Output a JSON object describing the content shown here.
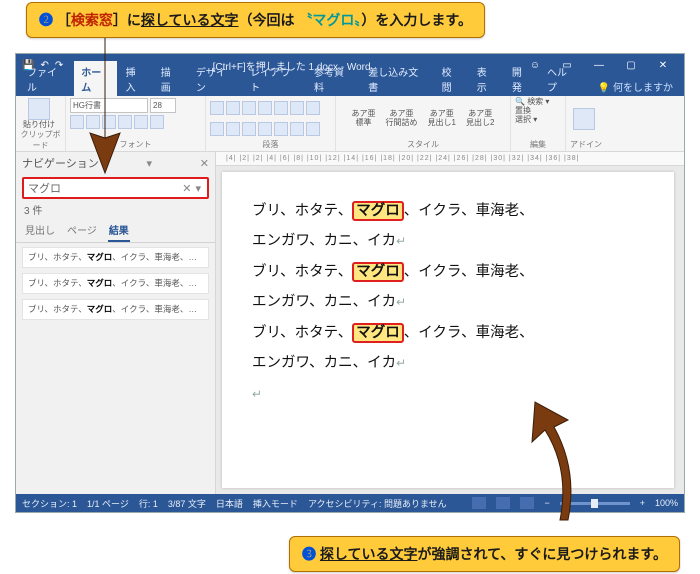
{
  "callouts": {
    "top": {
      "num": "❷",
      "p1": "［",
      "kw": "検索窓",
      "p2": "］に",
      "u": "探している文字",
      "p3": "（今回は ",
      "q": "〝マグロ〟",
      "p4": "）を入力します。"
    },
    "bot": {
      "num": "❸",
      "p1": " ",
      "u": "探している文字",
      "p2": "が強調されて、すぐに見つけられます。"
    }
  },
  "window": {
    "title": "[Ctrl+F]を押しました 1.docx - Word",
    "tabs": [
      "ファイル",
      "ホーム",
      "挿入",
      "描画",
      "デザイン",
      "レイアウト",
      "参考資料",
      "差し込み文書",
      "校閲",
      "表示",
      "開発",
      "ヘルプ"
    ],
    "tell": "何をしますか",
    "ribbon": {
      "font_name": "HG行書",
      "font_size": "28",
      "grp_clipboard": "クリップボード",
      "grp_font": "フォント",
      "grp_para": "段落",
      "grp_style": "スタイル",
      "grp_edit": "編集",
      "grp_addin": "アドイン",
      "style_labels": [
        "あア亜",
        "あア亜",
        "あア亜",
        "あア亜"
      ],
      "style_sub": [
        "標準",
        "行間詰め",
        "見出し1",
        "見出し2"
      ],
      "edit_items": [
        "検索",
        "置換",
        "選択"
      ]
    },
    "nav": {
      "heading": "ナビゲーション",
      "search_value": "マグロ",
      "count": "3 件",
      "tabs": [
        "見出し",
        "ページ",
        "結果"
      ],
      "row_pre": "ブリ、ホタテ、",
      "row_hit": "マグロ",
      "row_post": "、イクラ、車海老、エンガワ、カニ、イカ"
    },
    "doc": {
      "ruler": "|4| |2|   |2| |4| |6| |8| |10| |12| |14| |16| |18| |20| |22| |24| |26| |28| |30| |32| |34| |36| |38|",
      "line_a_pre": "ブリ、ホタテ、",
      "line_a_hit": "マグロ",
      "line_a_post": "、イクラ、車海老、",
      "line_b": "エンガワ、カニ、イカ"
    },
    "status": {
      "section": "セクション: 1",
      "page": "1/1 ページ",
      "line": "行: 1",
      "chars": "3/87 文字",
      "lang": "日本語",
      "ins": "挿入モード",
      "acc": "アクセシビリティ: 問題ありません",
      "zoom": "100%"
    }
  }
}
